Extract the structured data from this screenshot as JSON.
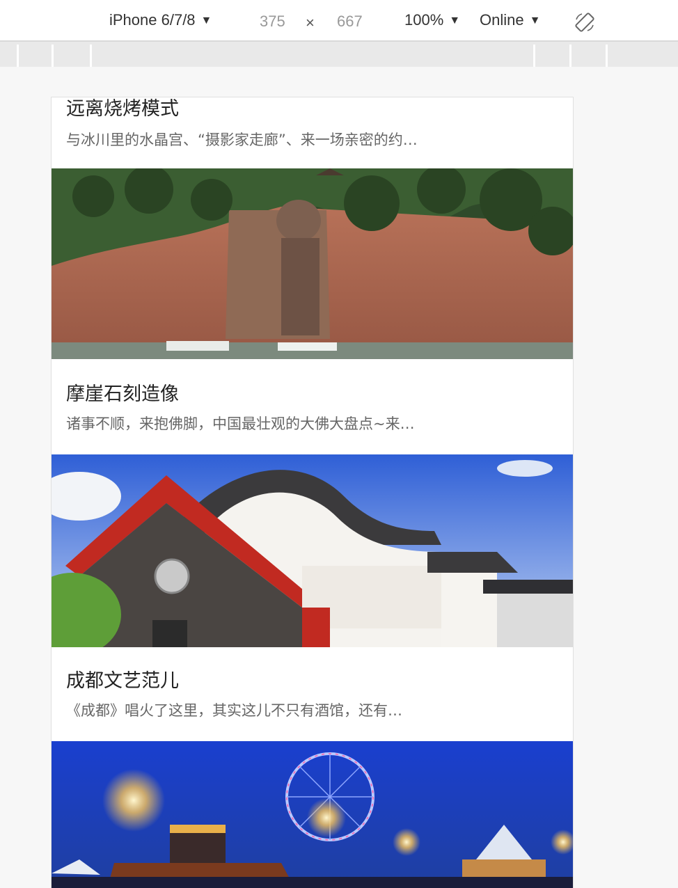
{
  "toolbar": {
    "device": "iPhone 6/7/8",
    "width_value": "375",
    "times_symbol": "×",
    "height_value": "667",
    "zoom": "100%",
    "network": "Online"
  },
  "cards": [
    {
      "title": "远离烧烤模式",
      "desc": "与冰川里的水晶宫、“摄影家走廊”、来一场亲密的约…",
      "image": "glacier-photo"
    },
    {
      "title": "摩崖石刻造像",
      "desc": "诸事不顺，来抱佛脚，中国最壮观的大佛大盘点~来…",
      "image": "leshan-giant-buddha-photo"
    },
    {
      "title": "成都文艺范儿",
      "desc": "《成都》唱火了这里，其实这儿不只有酒馆，还有…",
      "image": "traditional-architecture-photo"
    },
    {
      "image": "amusement-park-night-photo"
    }
  ],
  "colors": {
    "accent_sky": "#2f5fd6",
    "title_text": "#222222",
    "desc_text": "#666666"
  }
}
